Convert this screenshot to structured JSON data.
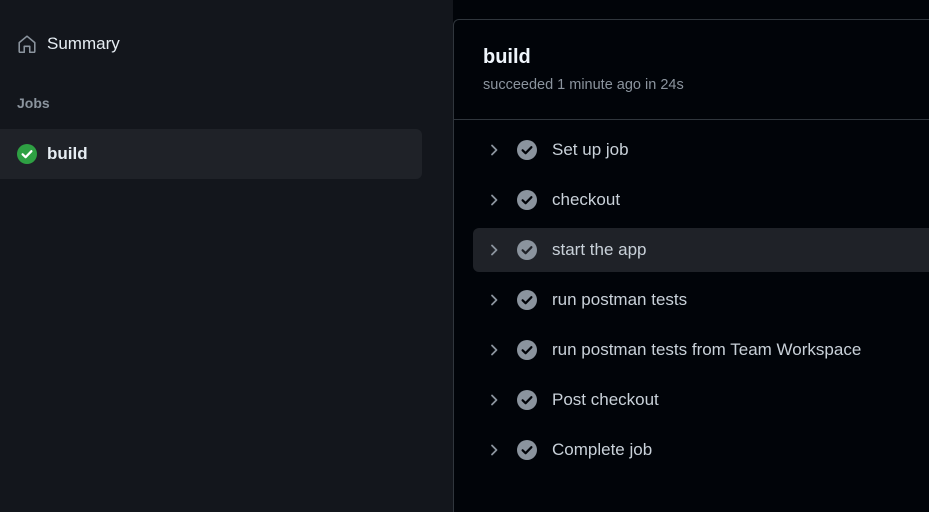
{
  "sidebar": {
    "summary_label": "Summary",
    "jobs_heading": "Jobs",
    "jobs": [
      {
        "label": "build",
        "status": "success"
      }
    ]
  },
  "job_detail": {
    "title": "build",
    "subtitle": "succeeded 1 minute ago in 24s",
    "steps": [
      {
        "label": "Set up job"
      },
      {
        "label": "checkout"
      },
      {
        "label": "start the app"
      },
      {
        "label": "run postman tests"
      },
      {
        "label": "run postman tests from Team Workspace"
      },
      {
        "label": "Post checkout"
      },
      {
        "label": "Complete job"
      }
    ],
    "active_step_index": 2
  },
  "colors": {
    "success": "#2ea043",
    "step_check": "#8b949e",
    "sidebar_bg": "#13161c",
    "main_bg": "#010409"
  },
  "icons": {
    "summary": "home-icon",
    "job_status": "check-circle-icon",
    "step_expand": "chevron-right-icon",
    "step_status": "check-circle-icon"
  }
}
